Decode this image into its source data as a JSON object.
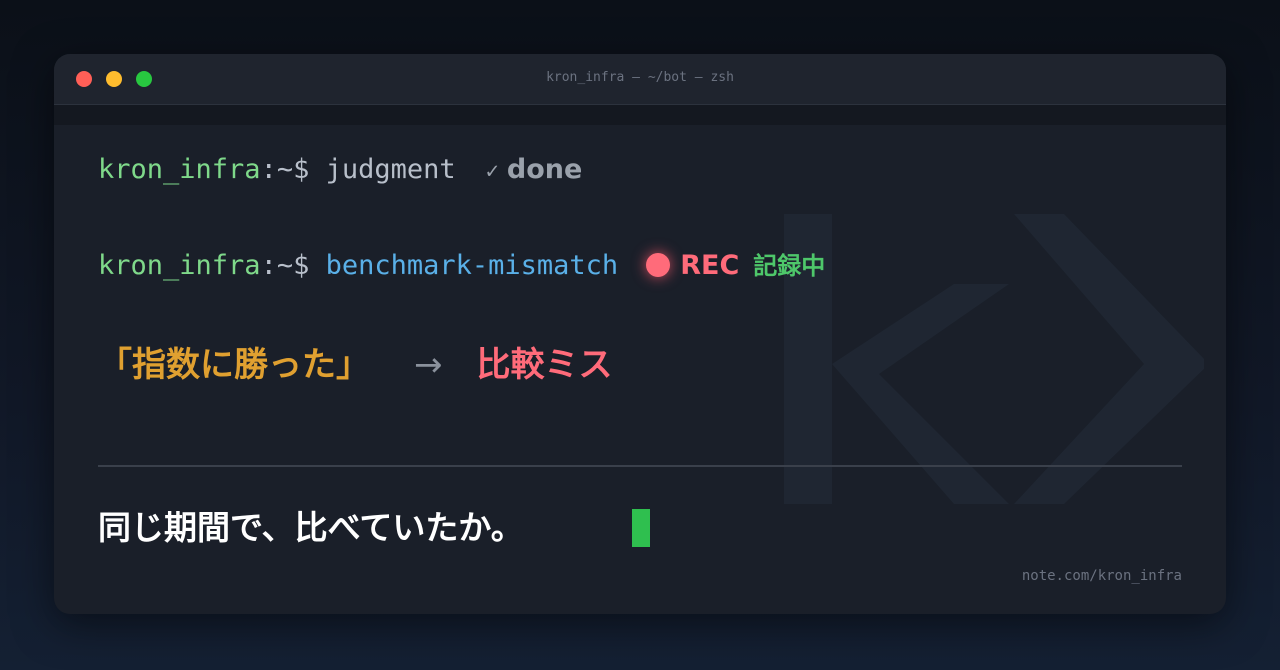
{
  "window": {
    "title": "kron_infra — ~/bot — zsh"
  },
  "terminal": {
    "line1": {
      "user": "kron_infra",
      "path": ":~$ ",
      "command": "judgment",
      "check": "✓",
      "status": "done"
    },
    "line2": {
      "user": "kron_infra",
      "path": ":~$ ",
      "command": "benchmark-mismatch",
      "rec": "REC",
      "rec_jp": "記録中"
    },
    "headline": {
      "quote": "「指数に勝った」",
      "arrow": "→",
      "result": "比較ミス"
    },
    "question": "同じ期間で、比べていたか。",
    "footer": "note.com/kron_infra"
  },
  "colors": {
    "prompt_user": "#7fd98a",
    "command_highlight": "#5ab0e8",
    "rec": "#ff6b7a",
    "rec_jp": "#4ec76a",
    "quote": "#e0a030",
    "cursor": "#2fbf4f"
  }
}
